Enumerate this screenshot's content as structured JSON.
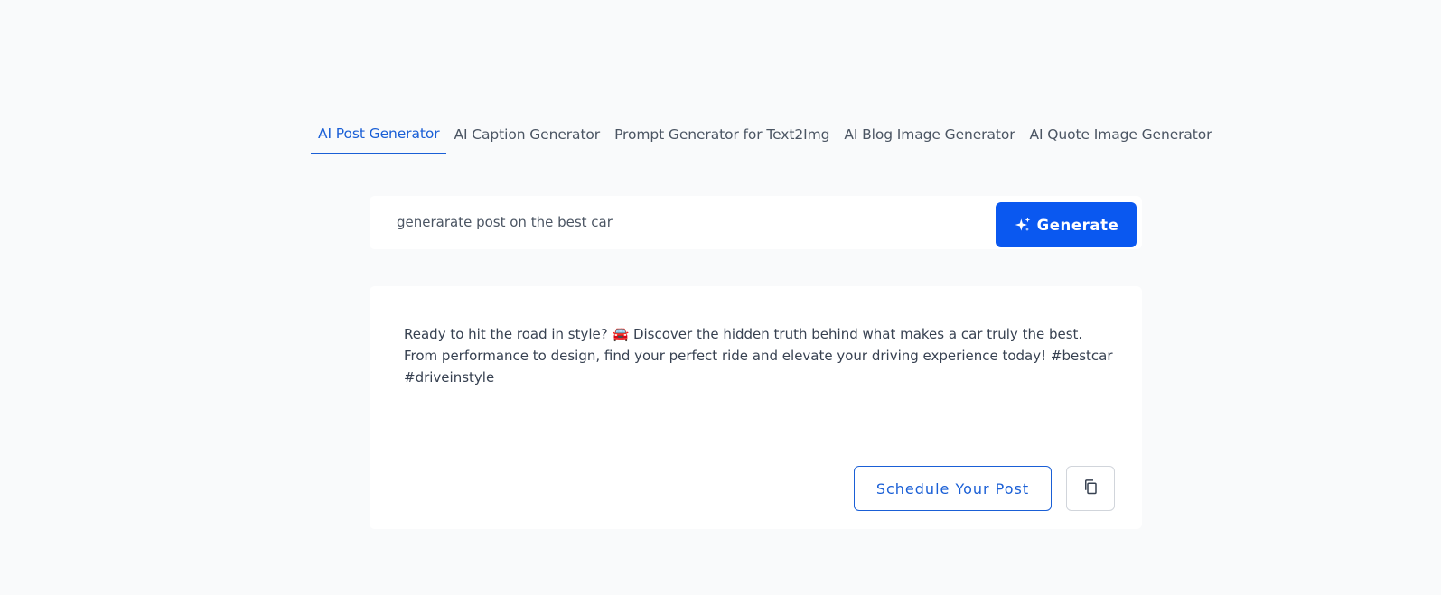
{
  "tabs": [
    {
      "label": "AI Post Generator",
      "active": true
    },
    {
      "label": "AI Caption Generator",
      "active": false
    },
    {
      "label": "Prompt Generator for Text2Img",
      "active": false
    },
    {
      "label": "AI Blog Image Generator",
      "active": false
    },
    {
      "label": "AI Quote Image Generator",
      "active": false
    }
  ],
  "prompt": {
    "value": "generarate post on the best car",
    "generate_label": "Generate",
    "generate_icon": "sparkles-icon"
  },
  "output": {
    "text": "Ready to hit the road in style? 🚘 Discover the hidden truth behind what makes a car truly the best. From performance to design, find your perfect ride and elevate your driving experience today! #bestcar #driveinstyle",
    "schedule_label": "Schedule Your Post",
    "copy_icon": "copy-icon"
  },
  "colors": {
    "accent": "#0a58f0",
    "active_tab": "#1a5fd6",
    "background": "#f9fafb"
  }
}
